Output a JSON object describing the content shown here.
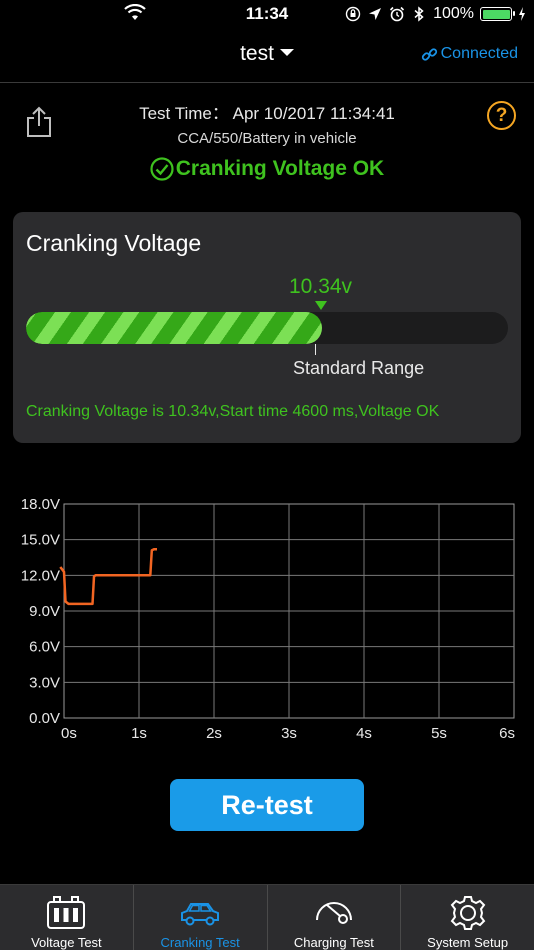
{
  "status_bar": {
    "time": "11:34",
    "battery_text": "100%"
  },
  "nav": {
    "title": "test",
    "connection": "Connected"
  },
  "header": {
    "test_time": "Test Time： Apr 10/2017 11:34:41",
    "config": "CCA/550/Battery in vehicle",
    "result": "Cranking Voltage OK",
    "help_symbol": "?"
  },
  "card": {
    "title": "Cranking Voltage",
    "value": "10.34v",
    "bar_fill_fraction": 0.615,
    "range_label": "Standard Range",
    "summary": "Cranking Voltage is 10.34v,Start time 4600 ms,Voltage OK"
  },
  "chart_data": {
    "type": "line",
    "y_ticks": [
      "18.0V",
      "15.0V",
      "12.0V",
      "9.0V",
      "6.0V",
      "3.0V",
      "0.0V"
    ],
    "x_ticks": [
      "0s",
      "1s",
      "2s",
      "3s",
      "4s",
      "5s",
      "6s"
    ],
    "xlim": [
      0,
      6
    ],
    "ylim": [
      0,
      18
    ],
    "grid": true,
    "series": [
      {
        "color": "#f26522",
        "x": [
          -0.05,
          0.0,
          0.02,
          0.06,
          0.35,
          0.38,
          0.4,
          0.42,
          1.13,
          1.15,
          1.17,
          1.2,
          1.24
        ],
        "y": [
          12.7,
          12.3,
          9.8,
          9.6,
          9.6,
          9.6,
          11.9,
          12.0,
          12.0,
          12.0,
          14.1,
          14.2,
          14.2
        ]
      }
    ]
  },
  "retest": {
    "label": "Re-test"
  },
  "tabs": [
    {
      "label": "Voltage Test",
      "icon": "battery-icon",
      "active": false
    },
    {
      "label": "Cranking Test",
      "icon": "car-icon",
      "active": true
    },
    {
      "label": "Charging Test",
      "icon": "gauge-icon",
      "active": false
    },
    {
      "label": "System Setup",
      "icon": "gear-icon",
      "active": false
    }
  ],
  "colors": {
    "accent_blue": "#1a93e6",
    "ok_green": "#3fc21f",
    "help_orange": "#f5a623",
    "trace_orange": "#f26522"
  }
}
